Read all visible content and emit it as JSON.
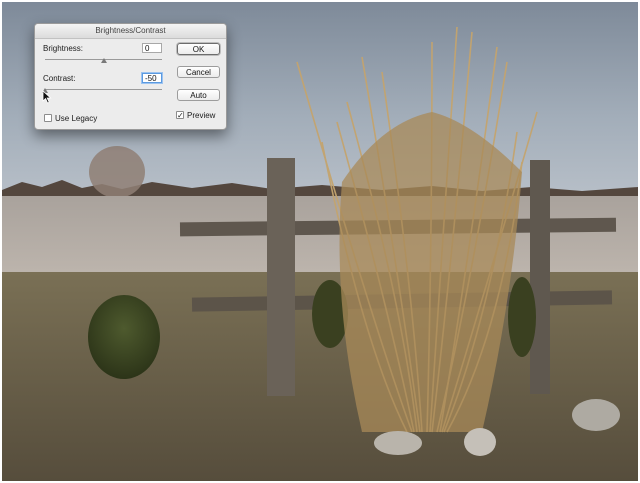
{
  "dialog": {
    "title": "Brightness/Contrast",
    "brightness": {
      "label": "Brightness:",
      "value": "0",
      "slider_level": 0.5
    },
    "contrast": {
      "label": "Contrast:",
      "value": "-50",
      "slider_level": 0.0
    },
    "buttons": {
      "ok": "OK",
      "cancel": "Cancel",
      "auto": "Auto"
    },
    "use_legacy": {
      "label": "Use Legacy",
      "checked": false
    },
    "preview": {
      "label": "Preview",
      "checked": true,
      "mark": "✓"
    }
  },
  "colors": {
    "dialog_bg": "#ececec",
    "sky": "#98a3b0",
    "field_dry": "#b5aea6",
    "grass": "#6e6650",
    "grass_plume": "#c4a46e",
    "post": "#6a6258"
  },
  "icons": {
    "cursor": "arrow-cursor-icon",
    "preview_check": "checkmark-icon"
  }
}
